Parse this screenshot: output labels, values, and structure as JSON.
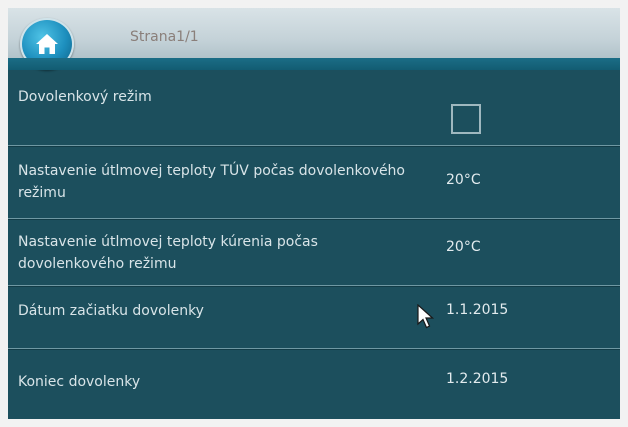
{
  "header": {
    "page_label": "Strana1/1",
    "home_icon": "home-icon"
  },
  "settings": {
    "vacation_mode": {
      "label": "Dovolenkový režim",
      "checked": false
    },
    "hot_water_temp": {
      "label": "Nastavenie útlmovej teploty TÚV počas dovolenkového režimu",
      "value": "20°C"
    },
    "heating_temp": {
      "label": "Nastavenie útlmovej teploty kúrenia počas dovolenkového režimu",
      "value": "20°C"
    },
    "start_date": {
      "label": "Dátum začiatku dovolenky",
      "value": "1.1.2015"
    },
    "end_date": {
      "label": "Koniec dovolenky",
      "value": "1.2.2015"
    }
  },
  "colors": {
    "panel": "#1c4f5d",
    "header": "#c4d2d8",
    "accent": "#1d8fbe"
  }
}
